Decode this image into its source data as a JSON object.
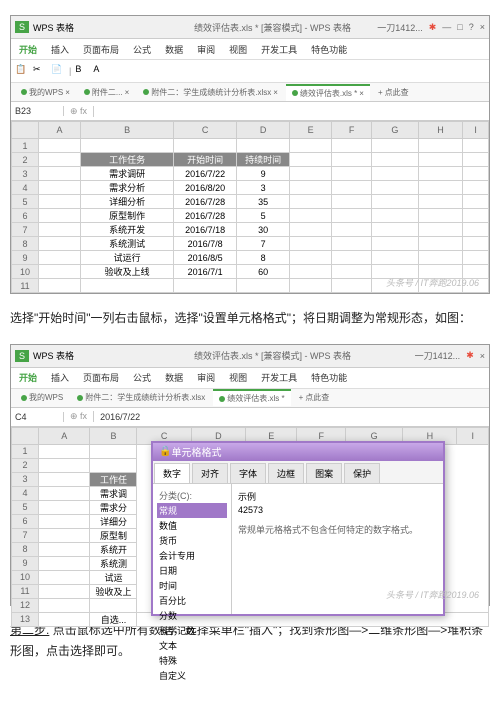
{
  "app": {
    "name": "WPS 表格",
    "title": "绩效评估表.xls * [兼容模式] - WPS 表格",
    "user": "一刀1412..."
  },
  "menu": {
    "i0": "开始",
    "i1": "插入",
    "i2": "页面布局",
    "i3": "公式",
    "i4": "数据",
    "i5": "审阅",
    "i6": "视图",
    "i7": "开发工具",
    "i8": "特色功能"
  },
  "tabs": {
    "t0": "我的WPS",
    "t1": "附件二...",
    "t2": "附件二：学生成绩统计分析表.xlsx",
    "t3": "绩效评估表.xls *",
    "t4": "点此查"
  },
  "s1": {
    "cellref": "B23",
    "fx": "fx",
    "cols": {
      "a": "A",
      "b": "B",
      "c": "C",
      "d": "D",
      "e": "E",
      "f": "F",
      "g": "G",
      "h": "H",
      "i": "I"
    },
    "rows": [
      "1",
      "2",
      "3",
      "4",
      "5",
      "6",
      "7",
      "8",
      "9",
      "10",
      "11"
    ],
    "h1": "工作任务",
    "h2": "开始时间",
    "h3": "持续时间",
    "r": [
      [
        "需求调研",
        "2016/7/22",
        "9"
      ],
      [
        "需求分析",
        "2016/8/20",
        "3"
      ],
      [
        "详细分析",
        "2016/7/28",
        "35"
      ],
      [
        "原型制作",
        "2016/7/28",
        "5"
      ],
      [
        "系统开发",
        "2016/7/18",
        "30"
      ],
      [
        "系统测试",
        "2016/7/8",
        "7"
      ],
      [
        "试运行",
        "2016/8/5",
        "8"
      ],
      [
        "验收及上线",
        "2016/7/1",
        "60"
      ]
    ]
  },
  "instr1": "选择\"开始时间\"一列右击鼠标，选择\"设置单元格格式\"；将日期调整为常规形态，如图：",
  "s2": {
    "cellref": "C4",
    "fx": "fx",
    "fval": "2016/7/22",
    "r": [
      [
        "",
        ""
      ],
      [
        "工作任",
        ""
      ],
      [
        "需求调",
        ""
      ],
      [
        "需求分",
        ""
      ],
      [
        "详细分",
        ""
      ],
      [
        "原型制",
        ""
      ],
      [
        "系统开",
        ""
      ],
      [
        "系统测",
        ""
      ],
      [
        "试运",
        ""
      ],
      [
        "验收及上",
        ""
      ],
      [
        "",
        ""
      ],
      [
        "自选...",
        ""
      ]
    ]
  },
  "dlg": {
    "title": "单元格格式",
    "icon": "🔒",
    "tabs": {
      "t0": "数字",
      "t1": "对齐",
      "t2": "字体",
      "t3": "边框",
      "t4": "图案",
      "t5": "保护"
    },
    "cat_label": "分类(C):",
    "cats": [
      "常规",
      "数值",
      "货币",
      "会计专用",
      "日期",
      "时间",
      "百分比",
      "分数",
      "科学记数",
      "文本",
      "特殊",
      "自定义"
    ],
    "sample_label": "示例",
    "sample": "42573",
    "desc": "常规单元格格式不包含任何特定的数字格式。"
  },
  "instr2a": "第二步.",
  "instr2b": "点击鼠标选中所有数据，选择菜单栏\"插入\"；找到条形图—>二维条形图—>堆积条形图，点击选择即可。",
  "wm": "头条号 / IT奔跑2019.06"
}
